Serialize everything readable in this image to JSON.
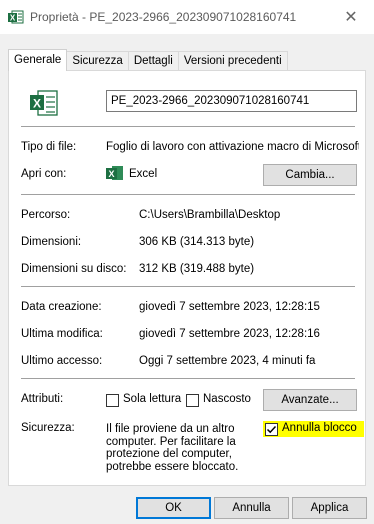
{
  "window": {
    "title": "Proprietà - PE_2023-2966_202309071028160741",
    "close_glyph": "✕"
  },
  "tabs": [
    {
      "label": "Generale",
      "active": true
    },
    {
      "label": "Sicurezza",
      "active": false
    },
    {
      "label": "Dettagli",
      "active": false
    },
    {
      "label": "Versioni precedenti",
      "active": false
    }
  ],
  "general": {
    "file_icon": "excel-file-icon",
    "file_name": "PE_2023-2966_202309071028160741",
    "file_type_label": "Tipo di file:",
    "file_type_value": "Foglio di lavoro con attivazione macro di Microsoft E:",
    "open_with_label": "Apri con:",
    "open_with_app": "Excel",
    "change_button": "Cambia...",
    "path_label": "Percorso:",
    "path_value": "C:\\Users\\Brambilla\\Desktop",
    "size_label": "Dimensioni:",
    "size_value": "306 KB (314.313 byte)",
    "size_on_disk_label": "Dimensioni su disco:",
    "size_on_disk_value": "312 KB (319.488 byte)",
    "created_label": "Data creazione:",
    "created_value": "giovedì 7 settembre 2023, 12:28:15",
    "modified_label": "Ultima modifica:",
    "modified_value": "giovedì 7 settembre 2023, 12:28:16",
    "accessed_label": "Ultimo accesso:",
    "accessed_value": "Oggi 7 settembre 2023, 4 minuti fa",
    "attributes_label": "Attributi:",
    "readonly_label": "Sola lettura",
    "readonly_checked": false,
    "hidden_label": "Nascosto",
    "hidden_checked": false,
    "advanced_button": "Avanzate...",
    "security_label": "Sicurezza:",
    "security_lines": [
      "Il file proviene da un altro",
      "computer. Per facilitare la",
      "protezione del computer,",
      "potrebbe essere bloccato."
    ],
    "unblock_label": "Annulla blocco",
    "unblock_checked": true
  },
  "footer": {
    "ok_button": "OK",
    "cancel_button": "Annulla",
    "apply_button": "Applica"
  },
  "colors": {
    "excel_green": "#1d6f42",
    "highlight": "#ffff00",
    "accent": "#0078d7"
  }
}
